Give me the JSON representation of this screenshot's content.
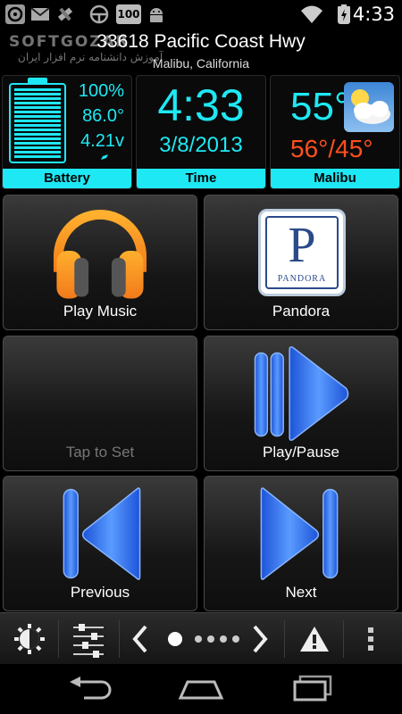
{
  "status_bar": {
    "time": "4:33",
    "icons": [
      "steering-wheel-icon",
      "gmail-icon",
      "satellite-icon",
      "steering-icon",
      "speed-limit-icon",
      "android-icon",
      "wifi-icon",
      "battery-charging-icon"
    ],
    "speed_limit": "100"
  },
  "location": {
    "address": "33618 Pacific Coast Hwy",
    "city": "Malibu, California"
  },
  "watermark": {
    "name": "SOFTGOZAR",
    "text": "آموزش دانشنامه نرم افزار ایران"
  },
  "battery": {
    "percent": "100%",
    "temperature": "86.0°",
    "voltage": "4.21v",
    "label": "Battery",
    "level": 1.0
  },
  "clock": {
    "time": "4:33",
    "date": "3/8/2013",
    "label": "Time"
  },
  "weather": {
    "temp": "55°",
    "high_low": "56°/45°",
    "label": "Malibu",
    "icon": "partly-cloudy-icon"
  },
  "buttons": [
    {
      "label": "Play Music",
      "icon": "headphones-icon"
    },
    {
      "label": "Pandora",
      "icon": "pandora-icon",
      "logo_letter": "P",
      "logo_text": "PANDORA"
    },
    {
      "label": "Tap to Set",
      "icon": ""
    },
    {
      "label": "Play/Pause",
      "icon": "play-pause-icon"
    },
    {
      "label": "Previous",
      "icon": "previous-icon"
    },
    {
      "label": "Next",
      "icon": "next-icon"
    }
  ],
  "toolbar": {
    "items": [
      "brightness-icon",
      "equalizer-icon",
      "chevron-left-icon",
      "page-indicator",
      "chevron-right-icon",
      "warning-icon",
      "overflow-menu-icon"
    ],
    "pages": 5,
    "current_page": 1
  },
  "navbar": {
    "items": [
      "back-icon",
      "home-icon",
      "recent-apps-icon"
    ]
  },
  "colors": {
    "accent": "#1ee8f4",
    "high_low": "#ff4f1f",
    "control_blue": "#3a7bff"
  }
}
